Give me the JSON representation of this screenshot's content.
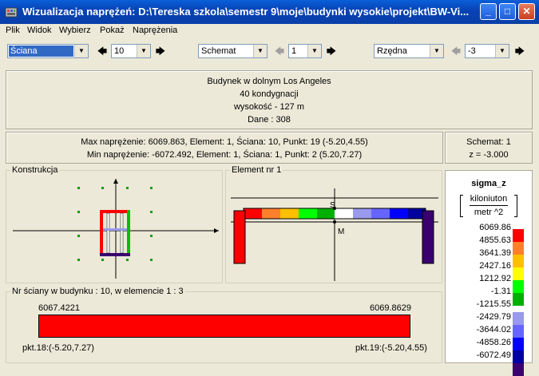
{
  "window": {
    "title": "Wizualizacja naprężeń: D:\\Tereska szkola\\semestr 9\\moje\\budynki wysokie\\projekt\\BW-Vi..."
  },
  "menu": [
    "Plik",
    "Widok",
    "Wybierz",
    "Pokaż",
    "Naprężenia"
  ],
  "toolbar": {
    "element_type": "Ściana",
    "element_number": "10",
    "view_mode": "Schemat",
    "schema_number": "1",
    "ordinate_label": "Rzędna",
    "ordinate_value": "-3"
  },
  "building": {
    "name": "Budynek w dolnym Los Angeles",
    "storeys": "40 kondygnacji",
    "height": "wysokość - 127 m",
    "data": "Dane :   308"
  },
  "stress": {
    "max_line": "Max naprężenie: 6069.863,   Element: 1,   Ściana: 10,   Punkt: 19 (-5.20,4.55)",
    "min_line": "Min naprężenie: -6072.492,   Element: 1,   Ściana: 1,   Punkt: 2 (5.20,7.27)",
    "schema": "Schemat: 1",
    "z": "z = -3.000"
  },
  "konstrukcja": {
    "label": "Konstrukcja"
  },
  "element": {
    "label": "Element nr 1",
    "s": "S",
    "m": "M"
  },
  "wall": {
    "label": "Nr ściany w budynku :  10,   w elemencie 1 :  3",
    "left_value": "6067.4221",
    "right_value": "6069.8629",
    "left_point": "pkt.18:(-5.20,7.27)",
    "right_point": "pkt.19:(-5.20,4.55)"
  },
  "legend": {
    "title": "sigma_z",
    "unit_top": "kiloniuton",
    "unit_bottom": "metr ^2",
    "values": [
      "6069.86",
      "4855.63",
      "3641.39",
      "2427.16",
      "1212.92",
      "-1.31",
      "-1215.55",
      "-2429.79",
      "-3644.02",
      "-4858.26",
      "-6072.49"
    ],
    "colors": [
      "#ff0000",
      "#ff7f2a",
      "#ffc000",
      "#ffff00",
      "#00ff00",
      "#00b000",
      "#ffffff",
      "#9999ee",
      "#6666ff",
      "#0000ff",
      "#0000a0",
      "#3a006f"
    ]
  }
}
